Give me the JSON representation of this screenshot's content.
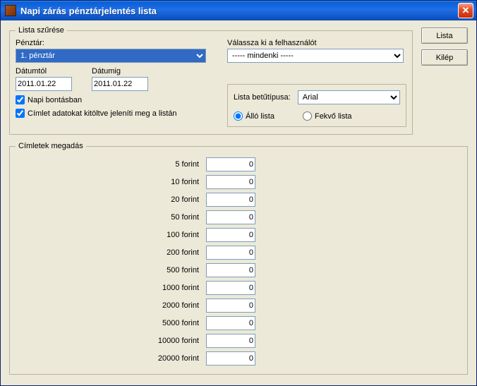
{
  "window": {
    "title": "Napi zárás pénztárjelentés lista"
  },
  "buttons": {
    "lista": "Lista",
    "kilep": "Kilép"
  },
  "filter": {
    "legend": "Lista szűrése",
    "penztar_label": "Pénztár:",
    "penztar_value": "1. pénztár",
    "user_label": "Válassza ki a felhasználót",
    "user_value": "----- mindenki -----",
    "date_from_label": "Dátumtól",
    "date_from_value": "2011.01.22",
    "date_to_label": "Dátumig",
    "date_to_value": "2011.01.22",
    "daily_label": "Napi bontásban",
    "denom_fill_label": "Címlet adatokat kitöltve jeleníti meg a listán",
    "font_label": "Lista betűtípusa:",
    "font_value": "Arial",
    "orientation": {
      "portrait": "Álló lista",
      "landscape": "Fekvő lista"
    }
  },
  "denom": {
    "legend": "Címletek megadás",
    "rows": [
      {
        "label": "5 forint",
        "value": "0"
      },
      {
        "label": "10 forint",
        "value": "0"
      },
      {
        "label": "20 forint",
        "value": "0"
      },
      {
        "label": "50 forint",
        "value": "0"
      },
      {
        "label": "100 forint",
        "value": "0"
      },
      {
        "label": "200 forint",
        "value": "0"
      },
      {
        "label": "500 forint",
        "value": "0"
      },
      {
        "label": "1000 forint",
        "value": "0"
      },
      {
        "label": "2000 forint",
        "value": "0"
      },
      {
        "label": "5000 forint",
        "value": "0"
      },
      {
        "label": "10000 forint",
        "value": "0"
      },
      {
        "label": "20000 forint",
        "value": "0"
      }
    ]
  }
}
